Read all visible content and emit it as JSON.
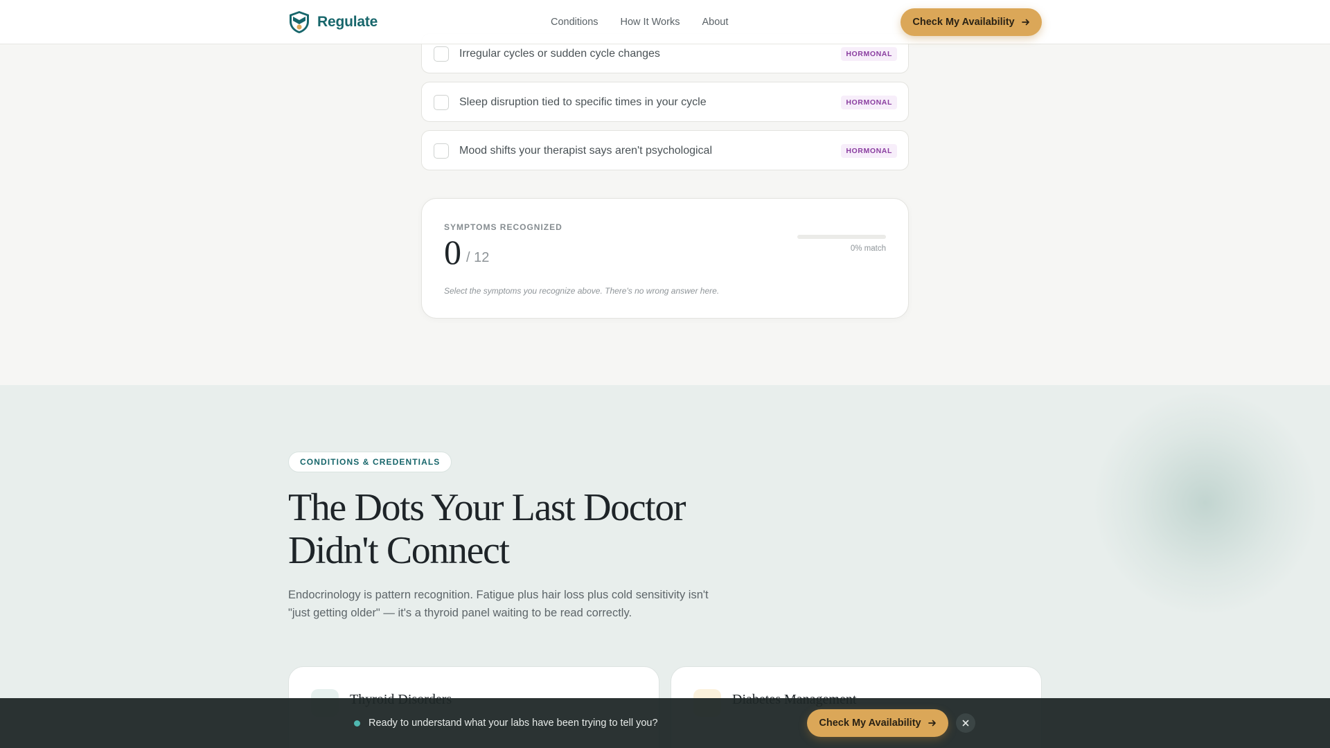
{
  "header": {
    "brand": "Regulate",
    "nav": [
      "Conditions",
      "How It Works",
      "About"
    ],
    "cta_label": "Check My Availability"
  },
  "symptoms": [
    {
      "text": "Irregular cycles or sudden cycle changes",
      "tag": "HORMONAL"
    },
    {
      "text": "Sleep disruption tied to specific times in your cycle",
      "tag": "HORMONAL"
    },
    {
      "text": "Mood shifts your therapist says aren't psychological",
      "tag": "HORMONAL"
    }
  ],
  "score": {
    "label": "SYMPTOMS RECOGNIZED",
    "count": "0",
    "total": "/ 12",
    "match_fraction": 0,
    "match_text": "0% match",
    "hint": "Select the symptoms you recognize above. There's no wrong answer here."
  },
  "conditions": {
    "eyebrow": "CONDITIONS & CREDENTIALS",
    "headline": "The Dots Your Last Doctor Didn't Connect",
    "lede": "Endocrinology is pattern recognition. Fatigue plus hair loss plus cold sensitivity isn't \"just getting older\" — it's a thyroid panel waiting to be read correctly.",
    "cards": [
      {
        "title": "Thyroid Disorders",
        "icon": "thyroid-icon",
        "icon_color": "#e6f0ee"
      },
      {
        "title": "Diabetes Management",
        "icon": "droplet-icon",
        "icon_color": "#fbf1dc"
      }
    ]
  },
  "sticky_bar": {
    "text": "Ready to understand what your labs have been trying to tell you?",
    "cta_label": "Check My Availability"
  },
  "colors": {
    "brand": "#17666b",
    "accent": "#dba758",
    "tag": "#8a3ea0"
  }
}
